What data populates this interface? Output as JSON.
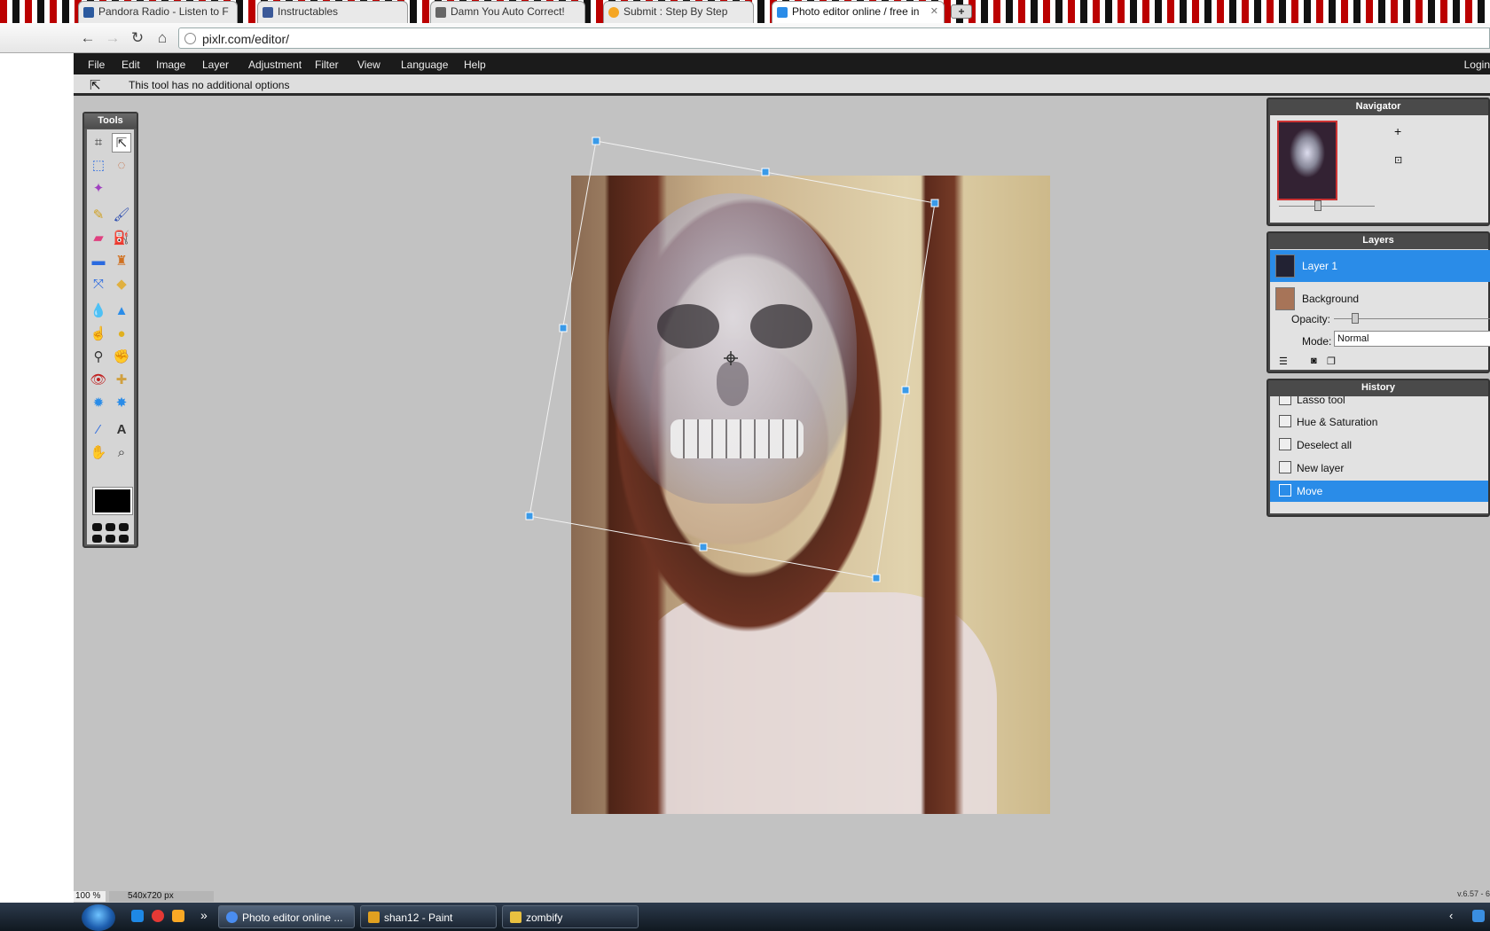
{
  "browser": {
    "tabs": [
      {
        "title": "Pandora Radio - Listen to F",
        "icon": "pandora-icon",
        "color": "#2c5a9e"
      },
      {
        "title": "Instructables",
        "icon": "facebook-icon",
        "color": "#3b5998"
      },
      {
        "title": "Damn You Auto Correct!",
        "icon": "phone-icon",
        "color": "#666666"
      },
      {
        "title": "Submit : Step By Step",
        "icon": "instructables-icon",
        "color": "#f5a623"
      },
      {
        "title": "Photo editor online / free in",
        "icon": "pixlr-icon",
        "color": "#2a8ce8"
      }
    ],
    "url": "pixlr.com/editor/"
  },
  "menubar": {
    "items": [
      "File",
      "Edit",
      "Image",
      "Layer",
      "Adjustment",
      "Filter",
      "View",
      "Language",
      "Help"
    ],
    "login": "Login"
  },
  "options_bar": {
    "text": "This tool has no additional options",
    "tool_icon": "move-tool-icon"
  },
  "tools": {
    "title": "Tools",
    "items": [
      "crop",
      "move",
      "marquee",
      "lasso",
      "wand",
      "pencil",
      "brush",
      "eraser",
      "bucket",
      "gradient",
      "stamp",
      "colorreplace",
      "drawing",
      "blur",
      "sharpen",
      "smudge",
      "sponge",
      "dodge",
      "burn",
      "redeye",
      "spotheal",
      "bloat",
      "pinch",
      "picker",
      "type",
      "hand",
      "zoom"
    ],
    "selected": "move",
    "primary_color": "#000000"
  },
  "canvas": {
    "zoom": "100 %",
    "size": "540x720 px"
  },
  "navigator": {
    "title": "Navigator"
  },
  "layers": {
    "title": "Layers",
    "items": [
      {
        "name": "Layer 1",
        "selected": true
      },
      {
        "name": "Background",
        "selected": false
      }
    ],
    "opacity_label": "Opacity:",
    "mode_label": "Mode:",
    "mode_value": "Normal"
  },
  "history": {
    "title": "History",
    "items": [
      {
        "name": "Lasso tool",
        "selected": false
      },
      {
        "name": "Hue & Saturation",
        "selected": false
      },
      {
        "name": "Deselect all",
        "selected": false
      },
      {
        "name": "New layer",
        "selected": false
      },
      {
        "name": "Move",
        "selected": true
      }
    ]
  },
  "version": "v.6.57 - 6",
  "taskbar": {
    "items": [
      {
        "label": "Photo editor online ...",
        "color": "#4a8df0"
      },
      {
        "label": "shan12 - Paint",
        "color": "#e0a020"
      },
      {
        "label": "zombify",
        "color": "#e8c040"
      }
    ],
    "more": "»"
  }
}
